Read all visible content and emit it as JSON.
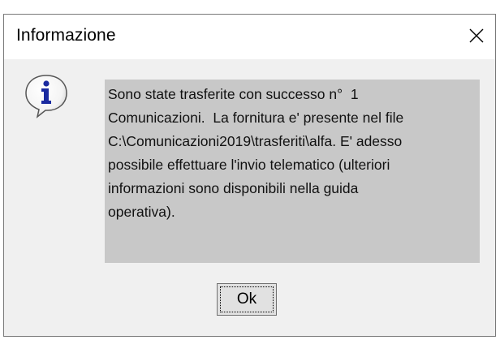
{
  "dialog": {
    "title": "Informazione",
    "close_icon": "close-icon",
    "icon": "information-icon",
    "message": "Sono state trasferite con successo n°  1\nComunicazioni.  La fornitura e' presente nel file\nC:\\Comunicazioni2019\\trasferiti\\alfa. E' adesso\npossibile effettuare l'invio telematico (ulteriori\ninformazioni sono disponibili nella guida\noperativa).",
    "ok_label": "Ok"
  },
  "colors": {
    "dialog_background": "#f0f0f0",
    "message_background": "#c8c8c8",
    "titlebar_background": "#ffffff",
    "icon_blue": "#1a2aa0"
  }
}
